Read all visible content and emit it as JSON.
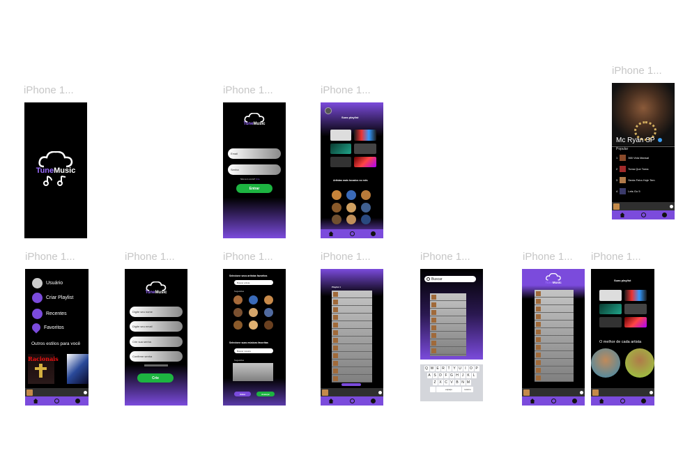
{
  "frame_label": "iPhone 1...",
  "brand": {
    "part1": "Tune",
    "part2": "Music"
  },
  "colors": {
    "purple": "#7b4bdc",
    "green": "#1db441",
    "black": "#000000"
  },
  "login": {
    "email_placeholder": "Email",
    "password_placeholder": "Senha",
    "signup_prompt": "Não tem conta?",
    "signup_link": "Crie",
    "submit": "Entrar"
  },
  "home": {
    "playlists_title": "Suas playlist",
    "artists_title": "Artistas mais tocados no mês"
  },
  "artist": {
    "name": "Mc Ryan SP",
    "popular_label": "Popular",
    "tracks": [
      {
        "num": "1",
        "title": "365 Vida Mansal"
      },
      {
        "num": "2",
        "title": "Toma Que Toma"
      },
      {
        "num": "3",
        "title": "Sexta Feira Hoje Tem"
      },
      {
        "num": "4",
        "title": "Lets Go 5"
      }
    ]
  },
  "menu": {
    "items": [
      "Usuário",
      "Criar Playlist",
      "Recentes",
      "Favoritos"
    ],
    "other_styles": "Outros estilos para você",
    "album_text": "Racionais"
  },
  "signup": {
    "fields": [
      "Digite seu nome",
      "Digite seu email",
      "Crie sua senha",
      "Confirme senha"
    ],
    "submit": "Crie"
  },
  "onboarding": {
    "artists_title": "Selecione seus artistas favoritos",
    "artists_search": "Buscar artista",
    "suggestions": "Sugestões",
    "songs_title": "Selecione suas músicas favoritas",
    "songs_search": "Buscar música",
    "back": "Voltar",
    "next": "Avançar"
  },
  "playlist": {
    "title": "Playlist 1"
  },
  "search": {
    "placeholder": "Buscar",
    "keyboard_rows": [
      [
        "Q",
        "W",
        "E",
        "R",
        "T",
        "Y",
        "U",
        "I",
        "O",
        "P"
      ],
      [
        "A",
        "S",
        "D",
        "F",
        "G",
        "H",
        "J",
        "K",
        "L"
      ],
      [
        "Z",
        "X",
        "C",
        "V",
        "B",
        "N",
        "M"
      ]
    ],
    "space": "espaço",
    "return": "retorno"
  },
  "home2": {
    "playlists_title": "Suas playlist",
    "best_of": "O melhor de cada artista"
  }
}
